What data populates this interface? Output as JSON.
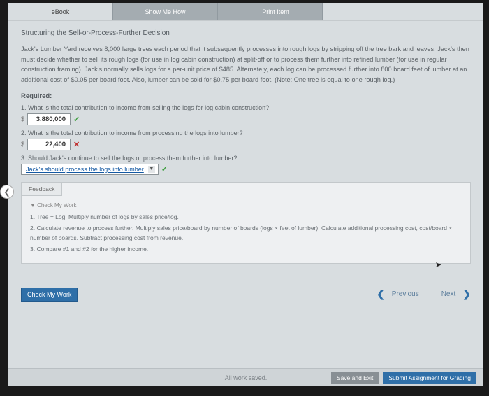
{
  "tabs": {
    "ebook": "eBook",
    "show": "Show Me How",
    "print": "Print Item"
  },
  "title": "Structuring the Sell-or-Process-Further Decision",
  "problem": "Jack's Lumber Yard receives 8,000 large trees each period that it subsequently processes into rough logs by stripping off the tree bark and leaves. Jack's then must decide whether to sell its rough logs (for use in log cabin construction) at split-off or to process them further into refined lumber (for use in regular construction framing). Jack's normally sells logs for a per-unit price of $485. Alternately, each log can be processed further into 800 board feet of lumber at an additional cost of $0.05 per board foot. Also, lumber can be sold for $0.75 per board foot. (Note: One tree is equal to one rough log.)",
  "required": "Required:",
  "q1": "1. What is the total contribution to income from selling the logs for log cabin construction?",
  "a1": "3,880,000",
  "q2": "2. What is the total contribution to income from processing the logs into lumber?",
  "a2": "22,400",
  "q3": "3. Should Jack's continue to sell the logs or process them further into lumber?",
  "a3": "Jack's should process the logs into lumber",
  "feedback": {
    "tab": "Feedback",
    "heading": "▼ Check My Work",
    "l1": "1. Tree = Log. Multiply number of logs by sales price/log.",
    "l2": "2. Calculate revenue to process further. Multiply sales price/board by number of boards (logs × feet of lumber). Calculate additional processing cost, cost/board × number of boards. Subtract processing cost from revenue.",
    "l3": "3. Compare #1 and #2 for the higher income."
  },
  "buttons": {
    "check": "Check My Work",
    "prev": "Previous",
    "next": "Next",
    "status": "All work saved.",
    "save": "Save and Exit",
    "submit": "Submit Assignment for Grading"
  }
}
